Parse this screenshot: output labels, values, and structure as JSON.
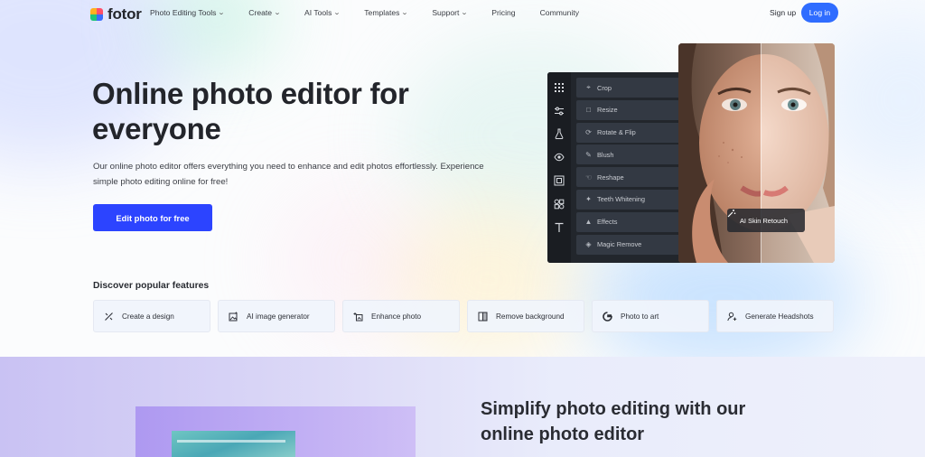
{
  "header": {
    "logo_text": "fotor",
    "nav": [
      {
        "label": "Photo Editing Tools",
        "has_dropdown": true
      },
      {
        "label": "Create",
        "has_dropdown": true
      },
      {
        "label": "AI Tools",
        "has_dropdown": true
      },
      {
        "label": "Templates",
        "has_dropdown": true
      },
      {
        "label": "Support",
        "has_dropdown": true
      },
      {
        "label": "Pricing",
        "has_dropdown": false
      },
      {
        "label": "Community",
        "has_dropdown": false
      }
    ],
    "signup_label": "Sign up",
    "login_label": "Log in",
    "accent_color": "#2f6cff"
  },
  "hero": {
    "title": "Online photo editor for everyone",
    "description": "Our online photo editor offers everything you need to enhance and edit photos effortlessly. Experience simple photo editing online for free!",
    "cta_label": "Edit photo for free",
    "cta_color": "#2c44ff"
  },
  "editor": {
    "tools": [
      {
        "icon": "grid-icon"
      },
      {
        "icon": "sliders-icon"
      },
      {
        "icon": "flask-icon"
      },
      {
        "icon": "eye-icon"
      },
      {
        "icon": "frame-icon"
      },
      {
        "icon": "shapes-icon"
      },
      {
        "icon": "text-icon"
      }
    ],
    "menu": [
      {
        "label": "Crop",
        "icon": "crop-icon"
      },
      {
        "label": "Resize",
        "icon": "resize-icon"
      },
      {
        "label": "Rotate & Flip",
        "icon": "rotate-icon"
      },
      {
        "label": "Blush",
        "icon": "brush-icon"
      },
      {
        "label": "Reshape",
        "icon": "reshape-icon"
      },
      {
        "label": "Teeth Whitening",
        "icon": "sparkle-icon"
      },
      {
        "label": "Effects",
        "icon": "effects-icon"
      },
      {
        "label": "Magic Remove",
        "icon": "eraser-icon"
      }
    ],
    "retouch_label": "AI Skin Retouch"
  },
  "features": {
    "title": "Discover popular features",
    "items": [
      {
        "label": "Create a design",
        "icon": "design-icon"
      },
      {
        "label": "AI image generator",
        "icon": "ai-image-icon"
      },
      {
        "label": "Enhance photo",
        "icon": "enhance-icon"
      },
      {
        "label": "Remove background",
        "icon": "remove-bg-icon"
      },
      {
        "label": "Photo to art",
        "icon": "photo-art-icon"
      },
      {
        "label": "Generate Headshots",
        "icon": "headshot-icon"
      }
    ]
  },
  "lower": {
    "title": "Simplify photo editing with our online photo editor"
  }
}
